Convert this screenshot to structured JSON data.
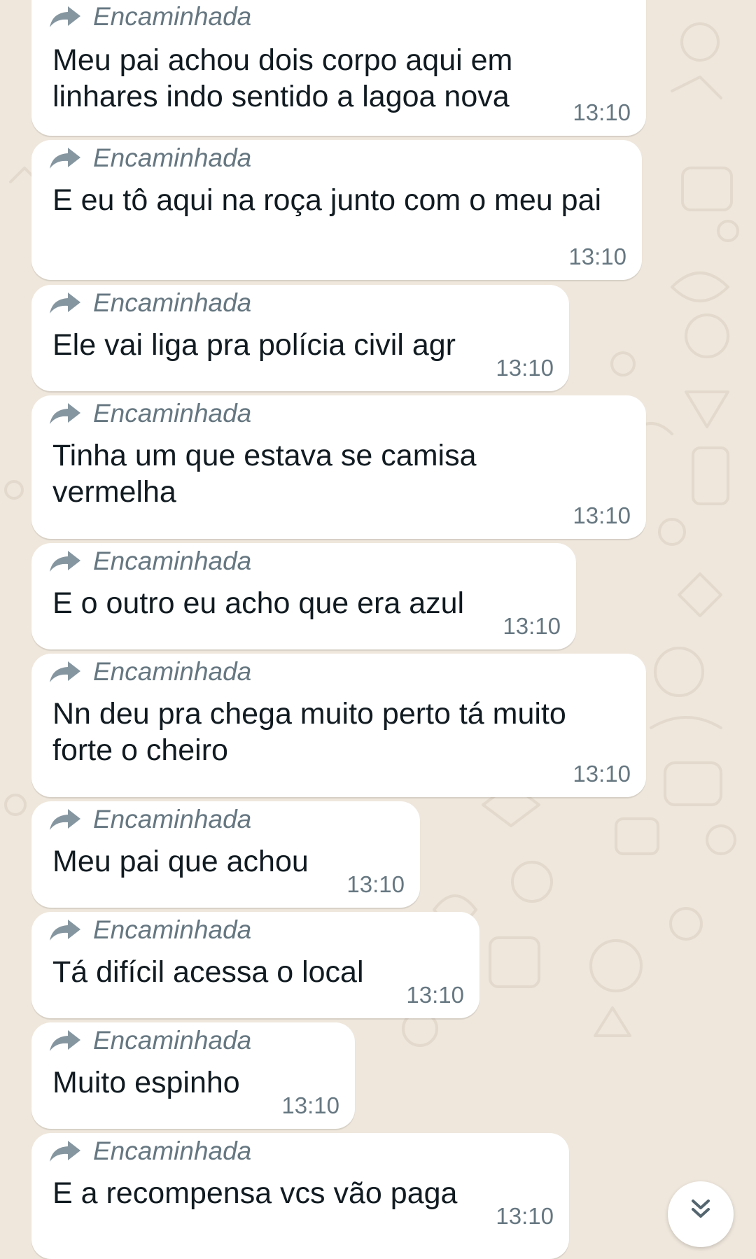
{
  "chat": {
    "forwarded_label": "Encaminhada",
    "messages": [
      {
        "lines": [
          "Meu pai achou dois corpo aqui em",
          "linhares indo sentido a lagoa nova"
        ],
        "time": "13:10"
      },
      {
        "lines": [
          "E eu tô aqui na roça junto com o meu pai"
        ],
        "time": "13:10"
      },
      {
        "lines": [
          "Ele vai liga pra polícia civil agr"
        ],
        "time": "13:10"
      },
      {
        "lines": [
          "Tinha um que estava se camisa",
          "vermelha"
        ],
        "time": "13:10"
      },
      {
        "lines": [
          "E o outro eu acho que era azul"
        ],
        "time": "13:10"
      },
      {
        "lines": [
          "Nn deu pra chega muito perto tá muito",
          "forte o cheiro"
        ],
        "time": "13:10"
      },
      {
        "lines": [
          "Meu pai que achou"
        ],
        "time": "13:10"
      },
      {
        "lines": [
          "Tá difícil acessa o local"
        ],
        "time": "13:10"
      },
      {
        "lines": [
          "Muito espinho"
        ],
        "time": "13:10"
      },
      {
        "lines": [
          "E a recompensa vcs vão paga"
        ],
        "time": "13:10"
      }
    ]
  },
  "icons": {
    "forward": "forward-arrow-icon",
    "scroll_down": "double-chevron-down-icon"
  },
  "colors": {
    "wallpaper": "#efe7dc",
    "bubble": "#ffffff",
    "text": "#111b21",
    "meta": "#667781"
  }
}
